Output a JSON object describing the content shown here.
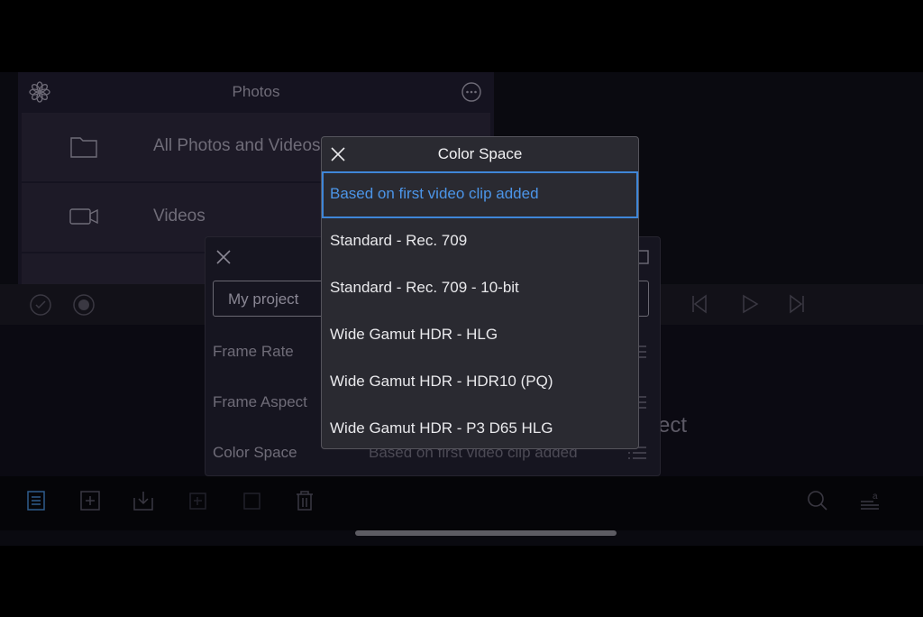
{
  "photos": {
    "title": "Photos",
    "rows": [
      {
        "label": "All Photos and Videos",
        "icon": "folder-icon"
      },
      {
        "label": "Videos",
        "icon": "video-camera-icon"
      }
    ]
  },
  "background": {
    "project_hint": "ect"
  },
  "project_settings": {
    "project_name": "My project",
    "settings": [
      {
        "label": "Frame Rate",
        "value": ""
      },
      {
        "label": "Frame Aspect",
        "value": ""
      },
      {
        "label": "Color Space",
        "value": "Based on first video clip added"
      }
    ]
  },
  "color_space_popover": {
    "title": "Color Space",
    "selected_index": 0,
    "options": [
      "Based on first video clip added",
      "Standard - Rec. 709",
      "Standard - Rec. 709 - 10-bit",
      "Wide Gamut HDR - HLG",
      "Wide Gamut HDR - HDR10 (PQ)",
      "Wide Gamut HDR - P3 D65 HLG"
    ]
  },
  "colors": {
    "accent": "#4c95e8",
    "popover_bg": "#2a2a31",
    "background": "#000000"
  }
}
